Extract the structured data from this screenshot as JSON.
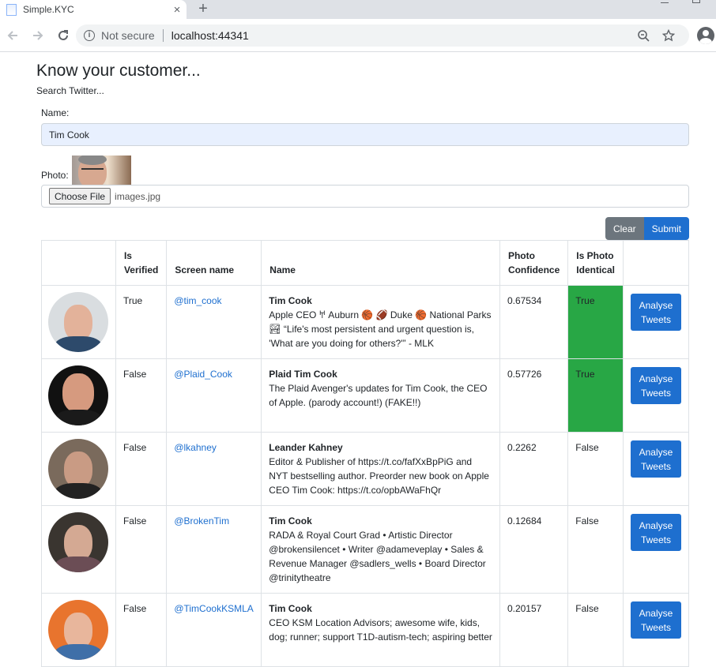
{
  "browser": {
    "tab_title": "Simple.KYC",
    "tab_close": "×",
    "new_tab": "+",
    "not_secure": "Not secure",
    "url": "localhost:44341"
  },
  "page": {
    "title": "Know your customer...",
    "subtitle": "Search Twitter..."
  },
  "form": {
    "name_label": "Name:",
    "name_value": "Tim Cook",
    "photo_label": "Photo:",
    "choose_file_label": "Choose File",
    "file_name": "images.jpg",
    "clear_label": "Clear",
    "submit_label": "Submit"
  },
  "table": {
    "headers": [
      "",
      "Is Verified",
      "Screen name",
      "Name",
      "Photo Confidence",
      "Is Photo Identical",
      ""
    ],
    "rows": [
      {
        "verified": "True",
        "screen_name": "@tim_cook",
        "name": "Tim Cook",
        "bio": "Apple CEO 𐀀 Auburn 🏀 🏈 Duke 🏀 National Parks 🏞 “Life's most persistent and urgent question is, 'What are you doing for others?'” - MLK",
        "confidence": "0.67534",
        "identical": "True",
        "action": "Analyse Tweets"
      },
      {
        "verified": "False",
        "screen_name": "@Plaid_Cook",
        "name": "Plaid Tim Cook",
        "bio": "The Plaid Avenger's updates for Tim Cook, the CEO of Apple. (parody account!) (FAKE!!)",
        "confidence": "0.57726",
        "identical": "True",
        "action": "Analyse Tweets"
      },
      {
        "verified": "False",
        "screen_name": "@lkahney",
        "name": "Leander Kahney",
        "bio": "Editor & Publisher of https://t.co/fafXxBpPiG and NYT bestselling author. Preorder new book on Apple CEO Tim Cook: https://t.co/opbAWaFhQr",
        "confidence": "0.2262",
        "identical": "False",
        "action": "Analyse Tweets"
      },
      {
        "verified": "False",
        "screen_name": "@BrokenTim",
        "name": "Tim Cook",
        "bio": "RADA & Royal Court Grad • Artistic Director @brokensilencet • Writer @adameveplay • Sales & Revenue Manager @sadlers_wells • Board Director @trinitytheatre",
        "confidence": "0.12684",
        "identical": "False",
        "action": "Analyse Tweets"
      },
      {
        "verified": "False",
        "screen_name": "@TimCookKSMLA",
        "name": "Tim Cook",
        "bio": "CEO KSM Location Advisors; awesome wife, kids, dog; runner; support T1D-autism-tech; aspiring better",
        "confidence": "0.20157",
        "identical": "False",
        "action": "Analyse Tweets"
      }
    ]
  },
  "colors": {
    "identical_true": "#28a745",
    "link": "#1e6fcf",
    "primary_button": "#1e6fcf",
    "secondary_button": "#6c757d"
  }
}
